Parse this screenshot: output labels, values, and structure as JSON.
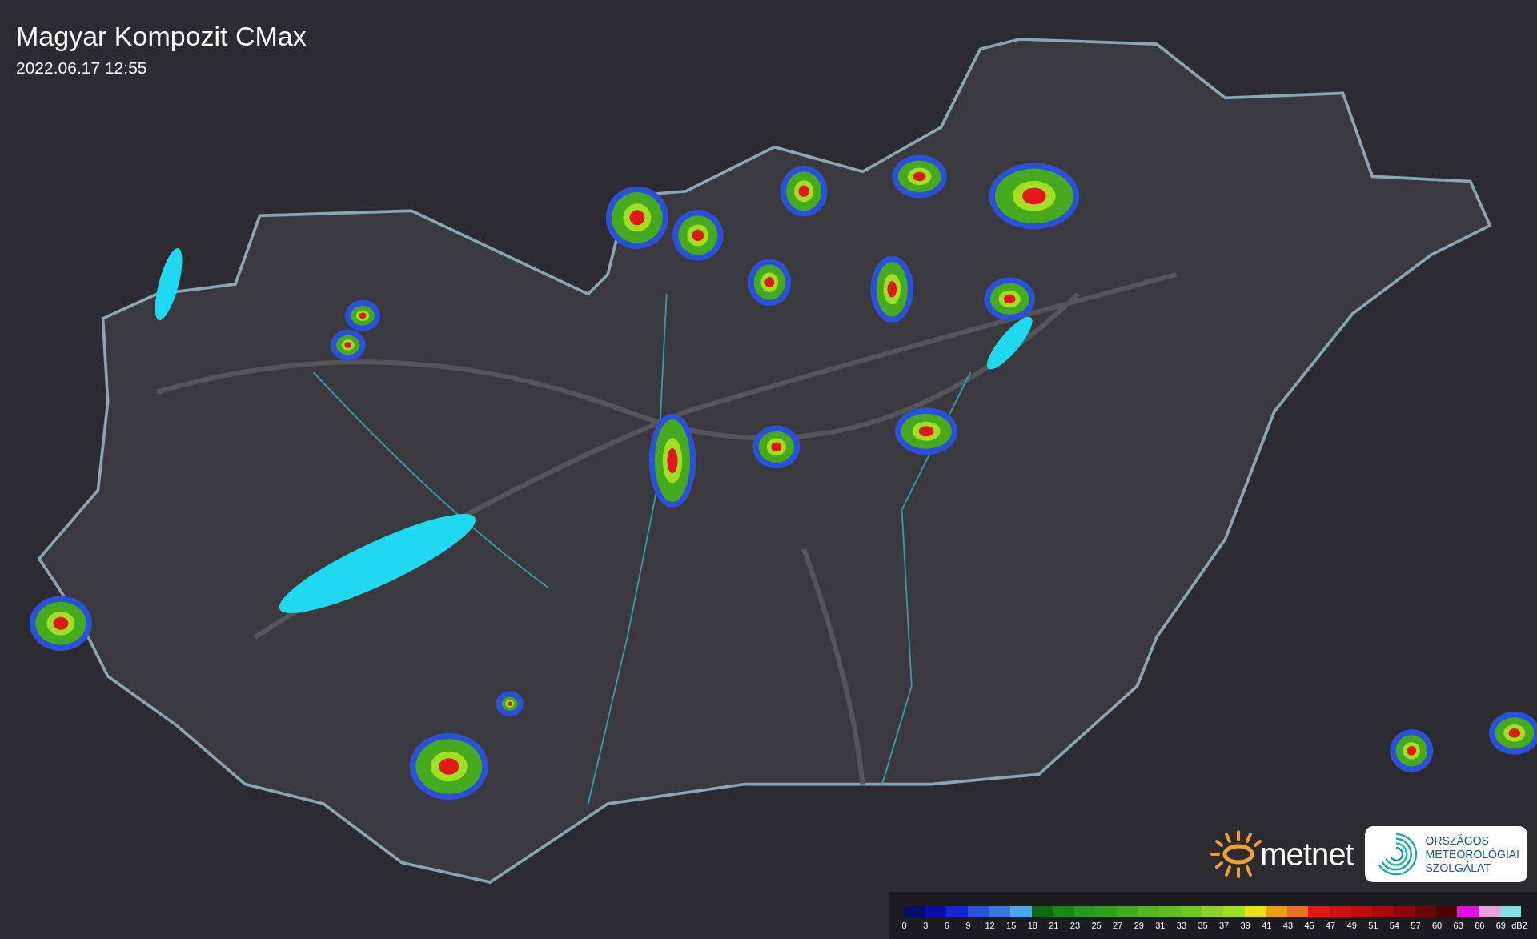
{
  "title": "Magyar Kompozit CMax",
  "timestamp": "2022.06.17 12:55",
  "logos": {
    "metnet": "metnet",
    "omsz": "ORSZÁGOS METEOROLÓGIAI SZOLGÁLAT"
  },
  "legend": {
    "unit": "dBZ",
    "swatches": [
      {
        "label": "0",
        "color": "#0a0a6e"
      },
      {
        "label": "3",
        "color": "#0510a8"
      },
      {
        "label": "6",
        "color": "#1428d0"
      },
      {
        "label": "9",
        "color": "#2a50dc"
      },
      {
        "label": "12",
        "color": "#3a78e0"
      },
      {
        "label": "15",
        "color": "#4aa8ec"
      },
      {
        "label": "18",
        "color": "#0e6a10"
      },
      {
        "label": "21",
        "color": "#1a8818"
      },
      {
        "label": "23",
        "color": "#249a1e"
      },
      {
        "label": "25",
        "color": "#329e1c"
      },
      {
        "label": "27",
        "color": "#46aa1e"
      },
      {
        "label": "29",
        "color": "#56b61e"
      },
      {
        "label": "31",
        "color": "#62be20"
      },
      {
        "label": "33",
        "color": "#72c822"
      },
      {
        "label": "35",
        "color": "#8ad428"
      },
      {
        "label": "37",
        "color": "#a0e022"
      },
      {
        "label": "39",
        "color": "#e8e010"
      },
      {
        "label": "41",
        "color": "#e8a010"
      },
      {
        "label": "43",
        "color": "#e87020"
      },
      {
        "label": "45",
        "color": "#e01818"
      },
      {
        "label": "47",
        "color": "#d01010"
      },
      {
        "label": "49",
        "color": "#c00c0c"
      },
      {
        "label": "51",
        "color": "#a80a0a"
      },
      {
        "label": "54",
        "color": "#8c0808"
      },
      {
        "label": "57",
        "color": "#6c0606"
      },
      {
        "label": "60",
        "color": "#4a0404"
      },
      {
        "label": "63",
        "color": "#e010e0"
      },
      {
        "label": "66",
        "color": "#e8a0e0"
      },
      {
        "label": "69",
        "color": "#80e0e0"
      }
    ]
  }
}
